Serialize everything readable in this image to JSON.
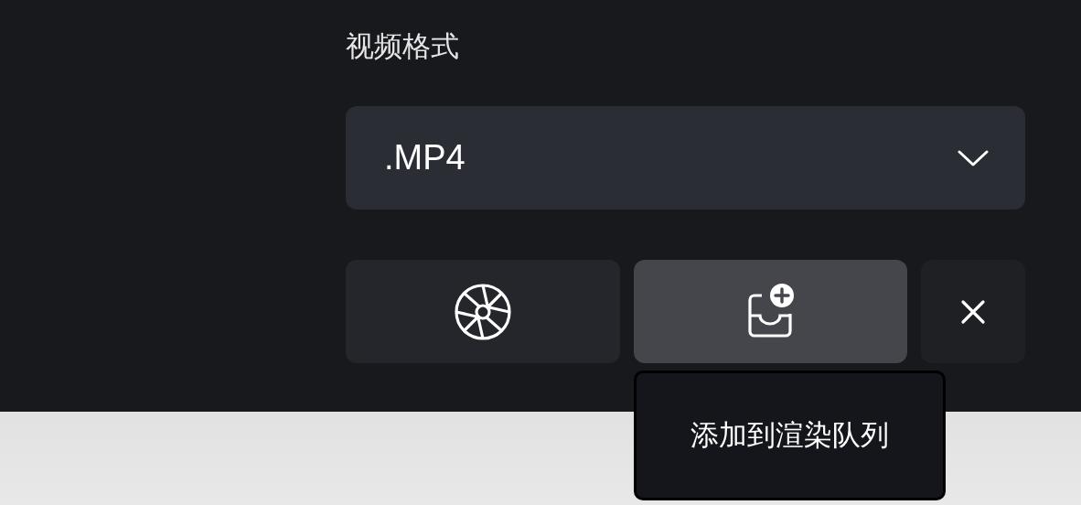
{
  "format_label": "视频格式",
  "format_select": {
    "value": ".MP4"
  },
  "buttons": [
    {
      "kind": "aperture",
      "hovered": false
    },
    {
      "kind": "queue-add",
      "hovered": true
    },
    {
      "kind": "close",
      "hovered": false
    }
  ],
  "tooltip": {
    "text": "添加到渲染队列"
  }
}
